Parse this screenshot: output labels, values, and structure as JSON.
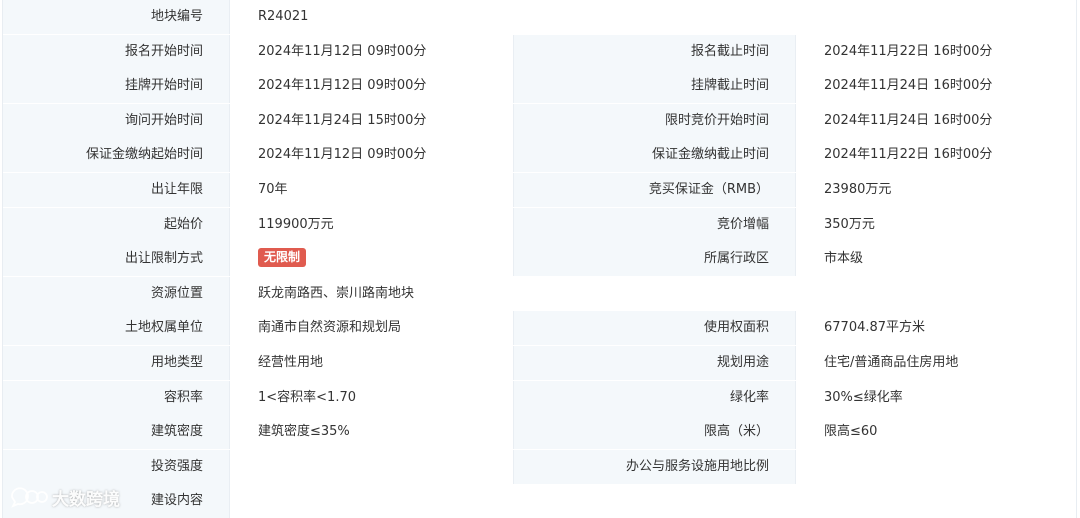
{
  "rows": [
    {
      "type": "full",
      "label": "地块编号",
      "value": "R24021"
    },
    {
      "type": "pair",
      "l1": "报名开始时间",
      "v1": "2024年11月12日 09时00分",
      "l2": "报名截止时间",
      "v2": "2024年11月22日 16时00分"
    },
    {
      "type": "pair",
      "l1": "挂牌开始时间",
      "v1": "2024年11月12日 09时00分",
      "l2": "挂牌截止时间",
      "v2": "2024年11月24日 16时00分"
    },
    {
      "type": "pair",
      "l1": "询问开始时间",
      "v1": "2024年11月24日 15时00分",
      "l2": "限时竞价开始时间",
      "v2": "2024年11月24日 16时00分"
    },
    {
      "type": "pair",
      "l1": "保证金缴纳起始时间",
      "v1": "2024年11月12日 09时00分",
      "l2": "保证金缴纳截止时间",
      "v2": "2024年11月22日 16时00分"
    },
    {
      "type": "pair",
      "l1": "出让年限",
      "v1": "70年",
      "l2": "竞买保证金（RMB）",
      "v2": "23980万元"
    },
    {
      "type": "pair",
      "l1": "起始价",
      "v1": "119900万元",
      "l2": "竞价增幅",
      "v2": "350万元"
    },
    {
      "type": "pair",
      "l1": "出让限制方式",
      "v1": "无限制",
      "v1_badge": true,
      "l2": "所属行政区",
      "v2": "市本级"
    },
    {
      "type": "full",
      "label": "资源位置",
      "value": "跃龙南路西、崇川路南地块"
    },
    {
      "type": "pair",
      "l1": "土地权属单位",
      "v1": "南通市自然资源和规划局",
      "l2": "使用权面积",
      "v2": "67704.87平方米"
    },
    {
      "type": "pair",
      "l1": "用地类型",
      "v1": "经营性用地",
      "l2": "规划用途",
      "v2": "住宅/普通商品住房用地"
    },
    {
      "type": "pair",
      "l1": "容积率",
      "v1": "1<容积率<1.70",
      "l2": "绿化率",
      "v2": "30%≤绿化率"
    },
    {
      "type": "pair",
      "l1": "建筑密度",
      "v1": "建筑密度≤35%",
      "l2": "限高（米）",
      "v2": "限高≤60"
    },
    {
      "type": "pair",
      "l1": "投资强度",
      "v1": "",
      "l2": "办公与服务设施用地比例",
      "v2": ""
    },
    {
      "type": "full",
      "label": "建设内容",
      "value": ""
    }
  ],
  "badge_color": "#e05b4f",
  "label_bg": "#f4f8fb",
  "watermark": {
    "text": "大数跨境",
    "icon": "wechat-bubble-icon"
  }
}
